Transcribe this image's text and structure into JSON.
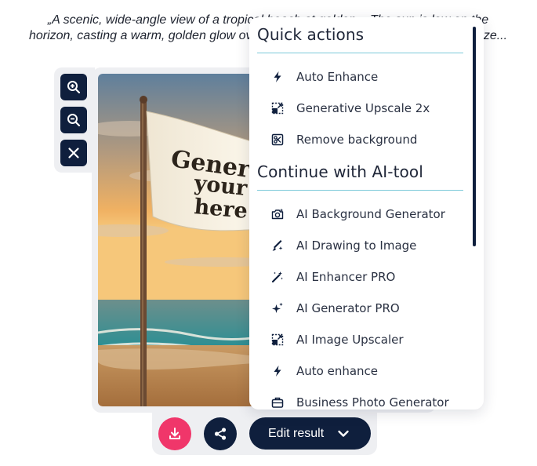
{
  "prompt": {
    "line1": "„A scenic, wide-angle view of a tropical beach at golden... The sun is low on the",
    "line2": "horizon, casting a warm, golden glow over the waves, sand and the flag. The breeze..."
  },
  "image": {
    "flag_line1": "Generate",
    "flag_line2": "your text",
    "flag_line3": "here"
  },
  "zoom_toolbar": {
    "zoom_in_icon": "zoom-in-icon",
    "zoom_out_icon": "zoom-out-icon",
    "close_icon": "close-icon"
  },
  "bottom_bar": {
    "edit_label": "Edit result",
    "download_icon": "download-icon",
    "share_icon": "share-icon"
  },
  "menu": {
    "quick_title": "Quick actions",
    "quick_items": [
      {
        "label": "Auto Enhance",
        "icon": "lightning-icon"
      },
      {
        "label": "Generative Upscale 2x",
        "icon": "upscale-icon"
      },
      {
        "label": "Remove background",
        "icon": "remove-bg-icon"
      }
    ],
    "continue_title": "Continue with AI-tool",
    "tool_items": [
      {
        "label": "AI Background Generator",
        "icon": "camera-sparkle-icon"
      },
      {
        "label": "AI Drawing to Image",
        "icon": "brush-sparkle-icon"
      },
      {
        "label": "AI Enhancer PRO",
        "icon": "magic-wand-icon"
      },
      {
        "label": "AI Generator PRO",
        "icon": "sparkles-icon"
      },
      {
        "label": "AI Image Upscaler",
        "icon": "upscale-icon"
      },
      {
        "label": "Auto enhance",
        "icon": "lightning-icon"
      },
      {
        "label": "Business Photo Generator",
        "icon": "briefcase-icon"
      }
    ]
  },
  "colors": {
    "navy": "#0f1f3d",
    "pink": "#f0366a",
    "divider": "#7cc9d9",
    "panel": "#eeeff2"
  }
}
